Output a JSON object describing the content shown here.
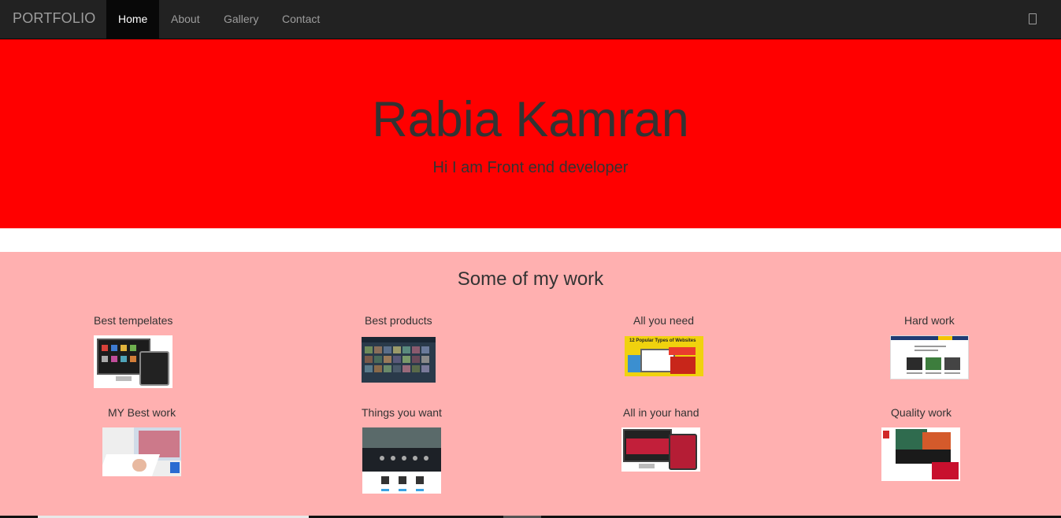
{
  "navbar": {
    "brand": "PORTFOLIO",
    "items": [
      {
        "label": "Home",
        "active": true
      },
      {
        "label": "About",
        "active": false
      },
      {
        "label": "Gallery",
        "active": false
      },
      {
        "label": "Contact",
        "active": false
      }
    ],
    "right_icon": "menu-icon"
  },
  "hero": {
    "name": "Rabia Kamran",
    "tagline": "Hi I am Front end developer",
    "background": "#ff0000"
  },
  "work": {
    "title": "Some of my work",
    "background": "#ffb0b0",
    "items": [
      {
        "caption": "Best tempelates"
      },
      {
        "caption": "Best products"
      },
      {
        "caption": "All you need",
        "image_text": "12 Popular Types of Websites"
      },
      {
        "caption": "Hard work"
      },
      {
        "caption": "MY Best work"
      },
      {
        "caption": "Things you want"
      },
      {
        "caption": "All in your hand"
      },
      {
        "caption": "Quality work"
      }
    ]
  }
}
